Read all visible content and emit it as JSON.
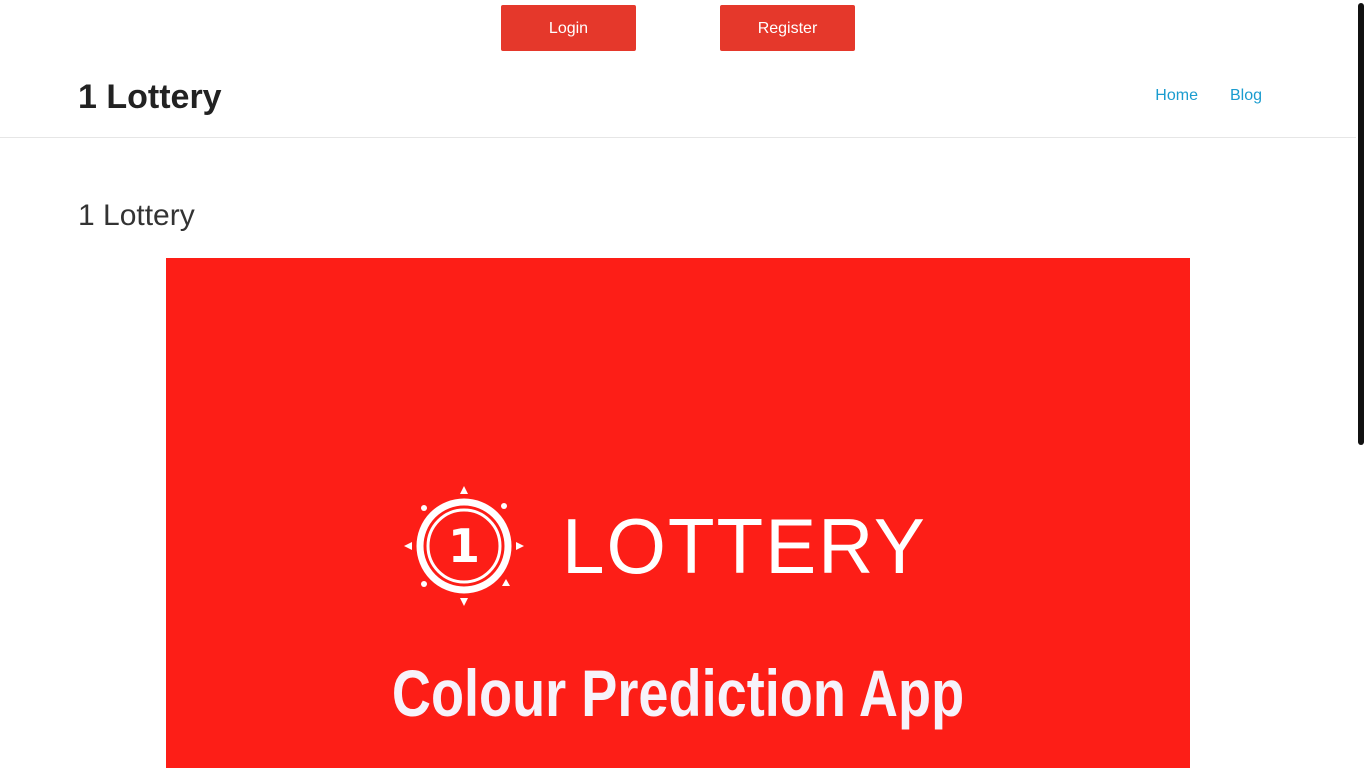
{
  "auth": {
    "login_label": "Login",
    "register_label": "Register",
    "button_color": "#e5382b"
  },
  "header": {
    "site_title": "1 Lottery",
    "nav": [
      {
        "label": "Home"
      },
      {
        "label": "Blog"
      }
    ],
    "link_color": "#1a9ccf"
  },
  "main": {
    "heading": "1 Lottery",
    "banner": {
      "brand": "LOTTERY",
      "logo_number": "1",
      "tagline": "Colour Prediction App",
      "background_color": "#fd1e17",
      "logo_icon": "lottery-ball-logo-icon"
    }
  }
}
